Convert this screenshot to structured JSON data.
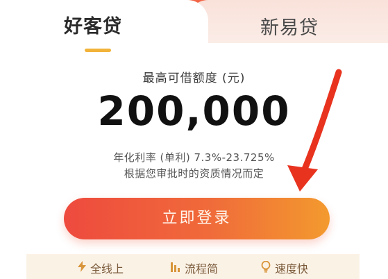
{
  "tabs": [
    {
      "label": "好客贷",
      "active": true
    },
    {
      "label": "新易贷",
      "active": false
    }
  ],
  "loan": {
    "limit_label": "最高可借额度 (元)",
    "amount": "200,000",
    "rate_text": "年化利率 (单利) 7.3%-23.725%",
    "rate_note": "根据您审批时的资质情况而定"
  },
  "actions": {
    "login_label": "立即登录"
  },
  "features": [
    {
      "icon": "lightning-icon",
      "label": "全线上"
    },
    {
      "icon": "bars-icon",
      "label": "流程简"
    },
    {
      "icon": "bulb-icon",
      "label": "速度快"
    }
  ],
  "colors": {
    "brand_red": "#ee4a3e",
    "brand_orange": "#f39a2e",
    "tab_underline": "#f2b33a",
    "annotation_arrow": "#e8331f"
  }
}
